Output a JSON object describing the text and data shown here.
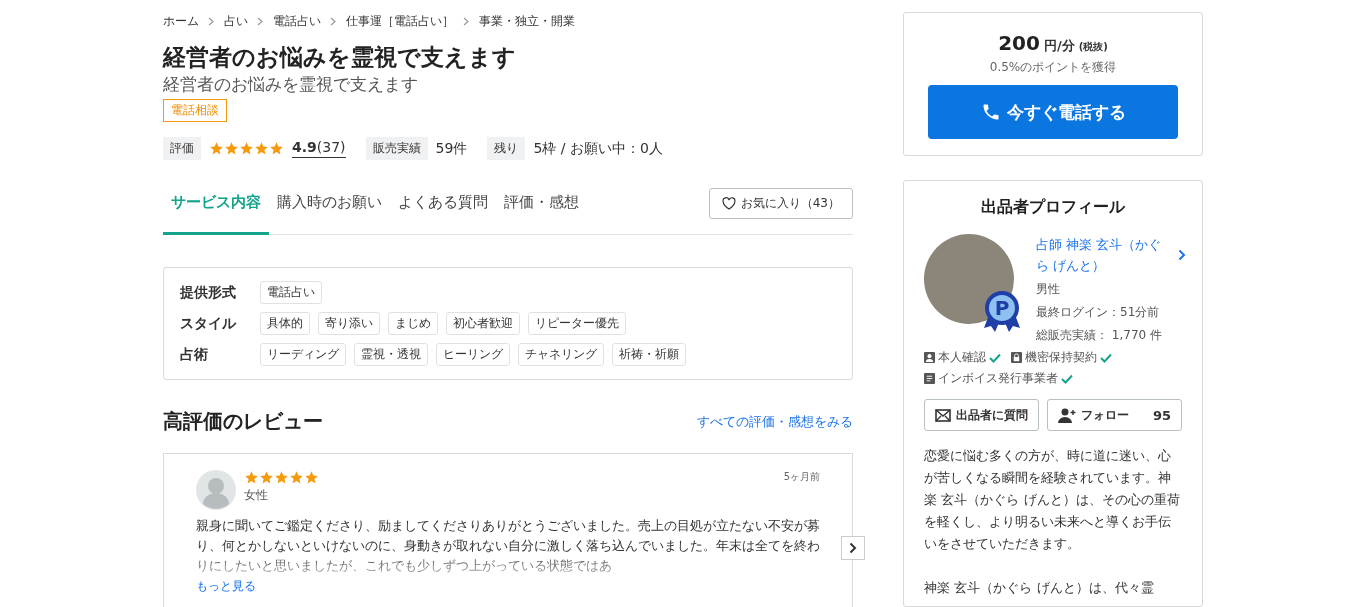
{
  "breadcrumbs": [
    "ホーム",
    "占い",
    "電話占い",
    "仕事運［電話占い］",
    "事業・独立・開業"
  ],
  "title": "経営者のお悩みを霊視で支えます",
  "subtitle": "経営者のお悩みを霊視で支えます",
  "tag": "電話相談",
  "stats": {
    "rating_label": "評価",
    "stars": 5,
    "score": "4.9",
    "count": "(37)",
    "sales_label": "販売実績",
    "sales": "59件",
    "remaining_label": "残り",
    "remaining": "5枠 / お願い中：0人"
  },
  "tabs": [
    {
      "label": "サービス内容",
      "selected": true
    },
    {
      "label": "購入時のお願い",
      "selected": false
    },
    {
      "label": "よくある質問",
      "selected": false
    },
    {
      "label": "評価・感想",
      "selected": false
    }
  ],
  "favorite": {
    "label": "お気に入り（43）"
  },
  "features": [
    {
      "label": "提供形式",
      "tags": [
        "電話占い"
      ]
    },
    {
      "label": "スタイル",
      "tags": [
        "具体的",
        "寄り添い",
        "まじめ",
        "初心者歓迎",
        "リピーター優先"
      ]
    },
    {
      "label": "占術",
      "tags": [
        "リーディング",
        "霊視・透視",
        "ヒーリング",
        "チャネリング",
        "祈祷・祈願"
      ]
    }
  ],
  "reviews_heading": "高評価のレビュー",
  "reviews_link": "すべての評価・感想をみる",
  "review": {
    "stars": 5,
    "gender": "女性",
    "time": "5ヶ月前",
    "text": "親身に聞いてご鑑定くださり、励ましてくださりありがとうございました。売上の目処が立たない不安が募り、何とかしないといけないのに、身動きが取れない自分に激しく落ち込んでいました。年末は全てを終わりにしたいと思いましたが、これでも少しずつ上がっている状態ではあ",
    "more": "もっと見る"
  },
  "price": {
    "amount": "200",
    "unit": "円/分",
    "tax": "(税抜)",
    "points": "0.5%のポイントを獲得",
    "call_button": "今すぐ電話する"
  },
  "profile": {
    "heading": "出品者プロフィール",
    "badge": "P",
    "name": "占師 神楽 玄斗（かぐら げんと）",
    "gender": "男性",
    "last_login": "最終ログイン：51分前",
    "total_sales": "総販売実績： 1,770 件",
    "verifications": [
      {
        "kind": "person",
        "label": "本人確認",
        "checked": true
      },
      {
        "kind": "lock",
        "label": "機密保持契約",
        "checked": true
      },
      {
        "kind": "document",
        "label": "インボイス発行事業者",
        "checked": true
      }
    ],
    "ask_button": "出品者に質問",
    "follow_button": "フォロー",
    "followers": "95",
    "bio": [
      "恋愛に悩む多くの方が、時に道に迷い、心が苦しくなる瞬間を経験されています。神楽 玄斗（かぐら げんと）は、その心の重荷を軽くし、より明るい未来へと導くお手伝いをさせていただきます。",
      "神楽 玄斗（かぐら げんと）は、代々霊"
    ]
  }
}
